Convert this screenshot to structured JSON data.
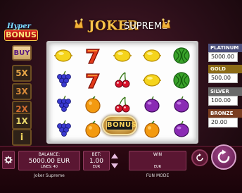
{
  "header": {
    "logo_word1": "JOKER",
    "logo_word2": "SUPREME",
    "hyper_top": "Hyper",
    "hyper_bottom": "BONUS"
  },
  "side": {
    "buy_label": "BUY",
    "multipliers": [
      "5X",
      "3X",
      "2X",
      "1X"
    ],
    "info_label": "i"
  },
  "reels": {
    "symbols": [
      [
        "lemon",
        "seven",
        "lemon",
        "lemon",
        "watermelon"
      ],
      [
        "grapes",
        "seven",
        "cherries",
        "lemon",
        "watermelon"
      ],
      [
        "grapes",
        "orange",
        "cherries",
        "plum",
        "plum"
      ],
      [
        "grapes",
        "orange",
        "bonus",
        "orange",
        "plum"
      ]
    ],
    "bonus_text": "BONUS"
  },
  "jackpots": [
    {
      "name": "PLATINUM",
      "value": "5000.00",
      "color": "#4c4f7c"
    },
    {
      "name": "GOLD",
      "value": "500.00",
      "color": "#8c6b16"
    },
    {
      "name": "SILVER",
      "value": "100.00",
      "color": "#6a6a6a"
    },
    {
      "name": "BRONZE",
      "value": "20.00",
      "color": "#7a3d20"
    }
  ],
  "bottom": {
    "balance_label": "BALANCE:",
    "balance_value": "5000.00 EUR",
    "lines": "LINES: 40",
    "bet_label": "BET:",
    "bet_value": "1.00",
    "bet_currency": "EUR",
    "win_label": "WIN",
    "win_currency": "EUR",
    "game_name": "Joker Supreme",
    "mode": "FUN MODE"
  }
}
